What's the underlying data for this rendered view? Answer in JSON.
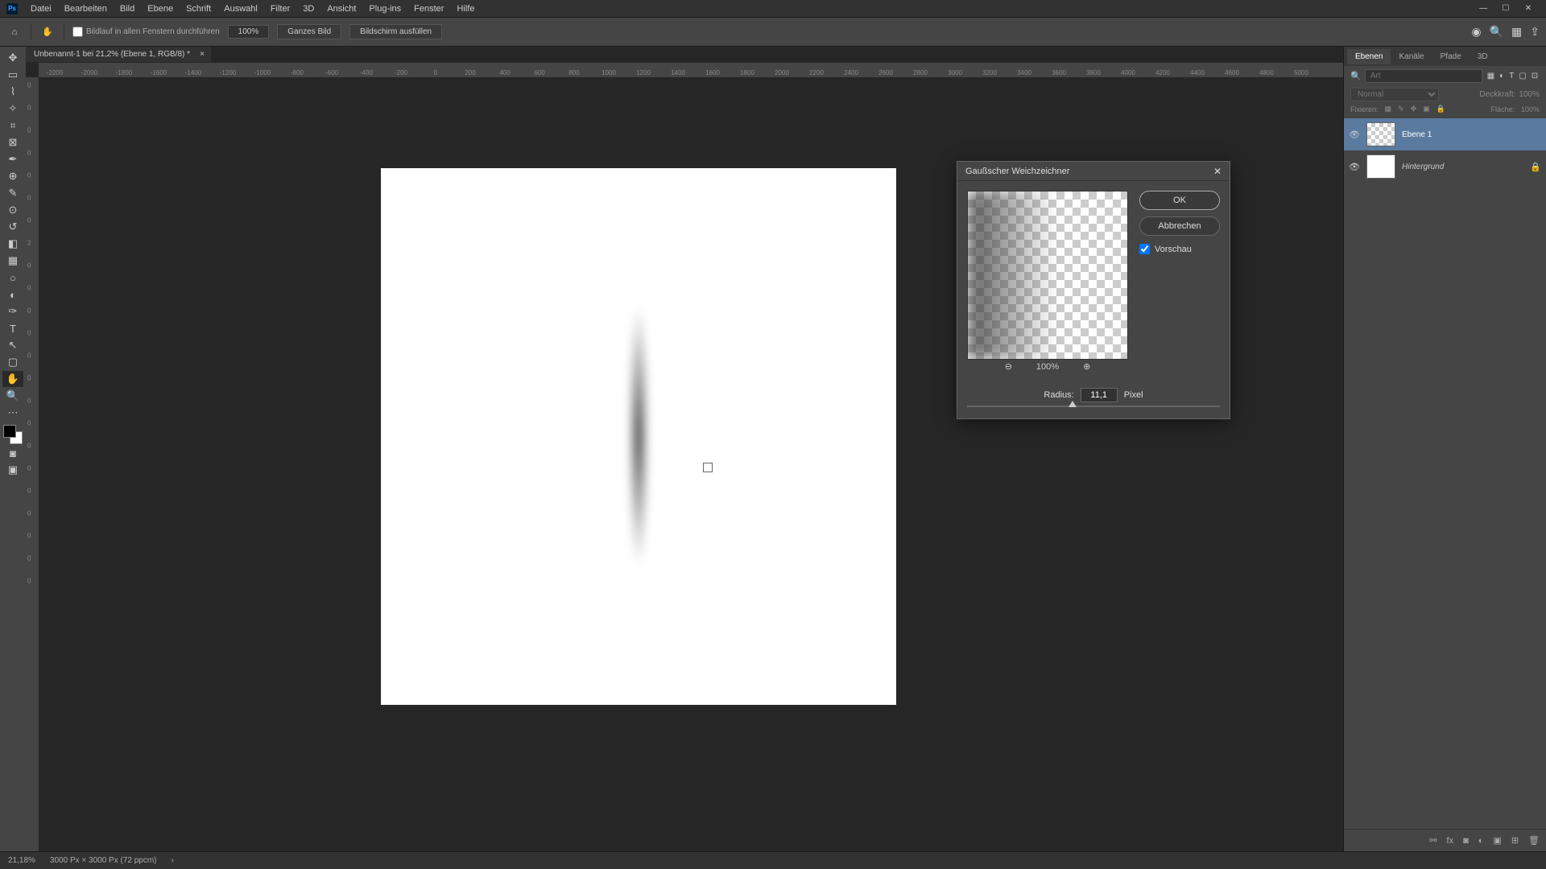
{
  "app": {
    "logo": "Ps"
  },
  "menu": [
    "Datei",
    "Bearbeiten",
    "Bild",
    "Ebene",
    "Schrift",
    "Auswahl",
    "Filter",
    "3D",
    "Ansicht",
    "Plug-ins",
    "Fenster",
    "Hilfe"
  ],
  "options": {
    "scroll_all": "Bildlauf in allen Fenstern durchführen",
    "zoom_val": "100%",
    "fit_all": "Ganzes Bild",
    "fill_screen": "Bildschirm ausfüllen"
  },
  "doc_tab": "Unbenannt-1 bei 21,2% (Ebene 1, RGB/8) *",
  "ruler_h": [
    "-2200",
    "-2000",
    "-1800",
    "-1600",
    "-1400",
    "-1200",
    "-1000",
    "-800",
    "-600",
    "-400",
    "-200",
    "0",
    "200",
    "400",
    "600",
    "800",
    "1000",
    "1200",
    "1400",
    "1600",
    "1800",
    "2000",
    "2200",
    "2400",
    "2600",
    "2800",
    "3000",
    "3200",
    "3400",
    "3600",
    "3800",
    "4000",
    "4200",
    "4400",
    "4600",
    "4800",
    "5000"
  ],
  "ruler_v": [
    "0",
    "0",
    "0",
    "0",
    "0",
    "0",
    "0",
    "2",
    "0",
    "0",
    "0",
    "0",
    "0",
    "0",
    "0",
    "0",
    "0",
    "0",
    "0",
    "0",
    "0",
    "0",
    "0"
  ],
  "panels": {
    "tabs": [
      "Ebenen",
      "Kanäle",
      "Pfade",
      "3D"
    ],
    "search_placeholder": "Art",
    "blend_mode": "Normal",
    "opacity_label": "Deckkraft:",
    "opacity_val": "100%",
    "lock_label": "Fixieren:",
    "fill_label": "Fläche:",
    "fill_val": "100%",
    "layers": [
      {
        "name": "Ebene 1",
        "selected": true,
        "checker": true,
        "locked": false
      },
      {
        "name": "Hintergrund",
        "selected": false,
        "checker": false,
        "locked": true
      }
    ]
  },
  "dialog": {
    "title": "Gaußscher Weichzeichner",
    "ok": "OK",
    "cancel": "Abbrechen",
    "preview": "Vorschau",
    "zoom": "100%",
    "radius_label": "Radius:",
    "radius_value": "11,1",
    "unit": "Pixel"
  },
  "status": {
    "zoom": "21,18%",
    "doc_info": "3000 Px × 3000 Px (72 ppcm)"
  }
}
